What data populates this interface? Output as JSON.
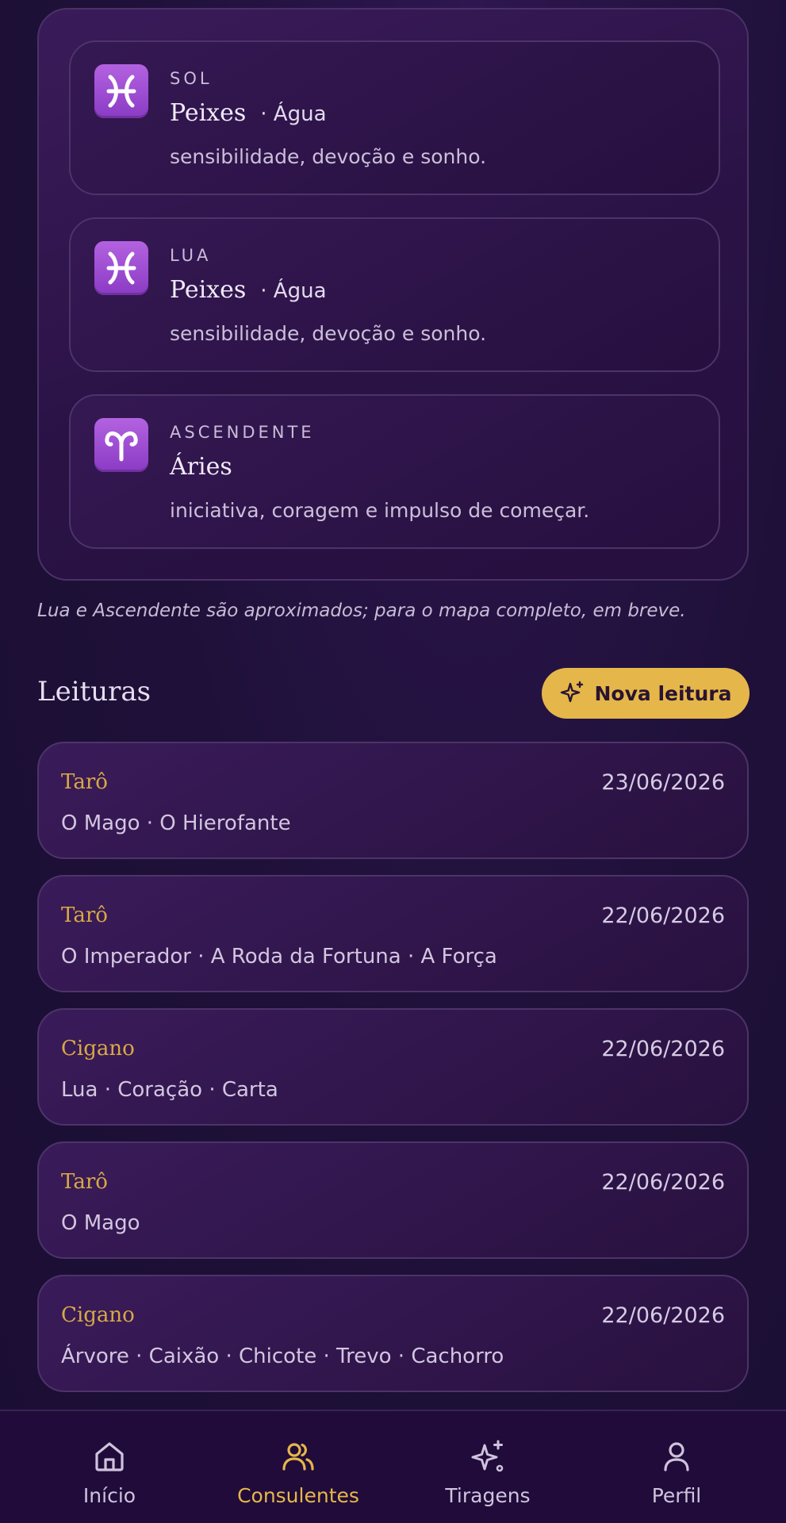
{
  "astro": {
    "signs": [
      {
        "label": "SOL",
        "name": "Peixes",
        "element": "· Água",
        "desc": "sensibilidade, devoção e sonho.",
        "icon": "pisces-icon"
      },
      {
        "label": "LUA",
        "name": "Peixes",
        "element": "· Água",
        "desc": "sensibilidade, devoção e sonho.",
        "icon": "pisces-icon"
      },
      {
        "label": "ASCENDENTE",
        "name": "Áries",
        "element": "",
        "desc": "iniciativa, coragem e impulso de começar.",
        "icon": "aries-icon"
      }
    ],
    "note": "Lua e Ascendente são aproximados; para o mapa completo, em breve."
  },
  "readings": {
    "title": "Leituras",
    "new_button": "Nova leitura",
    "items": [
      {
        "type": "Tarô",
        "date": "23/06/2026",
        "cards": "O Mago · O Hierofante"
      },
      {
        "type": "Tarô",
        "date": "22/06/2026",
        "cards": "O Imperador · A Roda da Fortuna · A Força"
      },
      {
        "type": "Cigano",
        "date": "22/06/2026",
        "cards": "Lua · Coração · Carta"
      },
      {
        "type": "Tarô",
        "date": "22/06/2026",
        "cards": "O Mago"
      },
      {
        "type": "Cigano",
        "date": "22/06/2026",
        "cards": "Árvore · Caixão · Chicote · Trevo · Cachorro"
      }
    ]
  },
  "nav": {
    "items": [
      {
        "label": "Início",
        "icon": "home-icon"
      },
      {
        "label": "Consulentes",
        "icon": "users-icon",
        "active": true
      },
      {
        "label": "Tiragens",
        "icon": "sparkles-icon"
      },
      {
        "label": "Perfil",
        "icon": "user-icon"
      }
    ]
  },
  "colors": {
    "accent": "#e5b74a",
    "background": "#1e1038",
    "card": "#2a1245",
    "sign_icon": "#a04fd6"
  }
}
